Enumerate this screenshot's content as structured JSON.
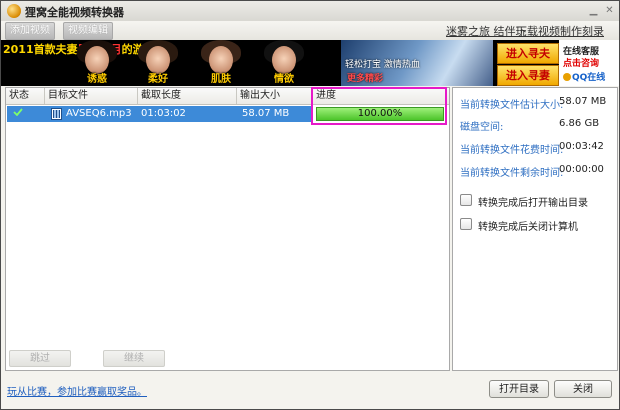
{
  "window": {
    "title": "狸窝全能视频转换器"
  },
  "toolbar": {
    "add_video_label": "添加视频",
    "video_edit_label": "视频编辑",
    "links": [
      "迷雾之旅 结伴玩",
      "下载视频",
      "制作刻录DVD"
    ]
  },
  "banner": {
    "headline_prefix": "2011首款",
    "headline_mid": "夫妻",
    "headline_hl": "风花雪月",
    "headline_suffix": "的游戏",
    "cards": [
      "诱惑",
      "柔好",
      "肌肤",
      "情欲"
    ],
    "scene_text": "轻松打宝 激情热血",
    "scene_sub": "更多精彩",
    "cta_top": "进入寻夫",
    "cta_bottom": "进入寻妻",
    "side_line1": "在线客服",
    "side_line2": "点击咨询",
    "side_line3": "QQ在线"
  },
  "table": {
    "headers": [
      "状态",
      "目标文件",
      "截取长度",
      "输出大小",
      "进度"
    ],
    "rows": [
      {
        "status": "done",
        "file": "AVSEQ6.mp3",
        "duration": "01:03:02",
        "size": "58.07 MB",
        "progress_text": "100.00%",
        "progress": 1.0
      }
    ]
  },
  "actions": {
    "skip_label": "跳过",
    "continue_label": "继续"
  },
  "info": {
    "items": [
      {
        "label": "当前转换文件估计大小:",
        "value": "58.07 MB"
      },
      {
        "label": "磁盘空间:",
        "value": "6.86 GB"
      },
      {
        "label": "当前转换文件花费时间:",
        "value": "00:03:42"
      },
      {
        "label": "当前转换文件剩余时间:",
        "value": "00:00:00"
      }
    ],
    "open_after_label": "转换完成后打开输出目录",
    "shutdown_after_label": "转换完成后关闭计算机"
  },
  "footer": {
    "promo_link": "玩从比赛，参加比赛赢取奖品。",
    "open_dir_label": "打开目录",
    "close_label": "关闭"
  },
  "colors": {
    "accent_blue": "#3d8ad8",
    "progress_green": "#4cc42a",
    "highlight_magenta": "#e61ac8",
    "label_blue": "#2f6fc2"
  },
  "icons": [
    "app-icon",
    "minimize-icon",
    "close-icon",
    "check-icon",
    "video-file-icon"
  ]
}
